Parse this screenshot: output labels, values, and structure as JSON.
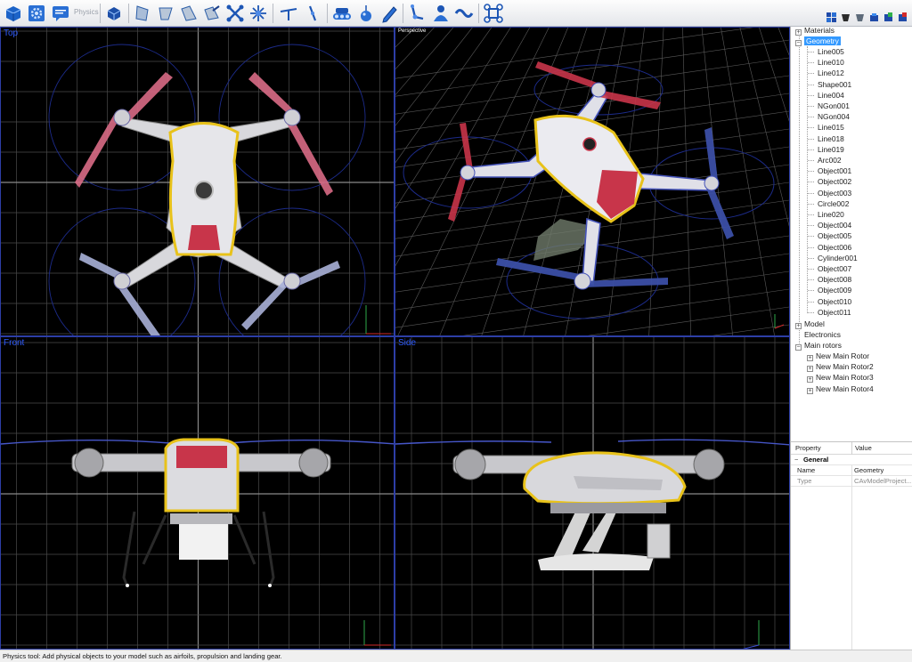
{
  "toolbar": {
    "physics_label": "Physics",
    "buttons": [
      {
        "name": "box-icon"
      },
      {
        "name": "gear-settings-icon"
      },
      {
        "name": "chat-icon"
      },
      {
        "name": "cube-physics-icon"
      },
      {
        "name": "wing-panel-icon"
      },
      {
        "name": "wing-taper-icon"
      },
      {
        "name": "wing-sweep-icon"
      },
      {
        "name": "wing-pen-icon"
      },
      {
        "name": "quadcopter-frame-icon"
      },
      {
        "name": "burst-icon"
      },
      {
        "name": "rotor-blade-icon"
      },
      {
        "name": "propeller-icon"
      },
      {
        "name": "tank-tracks-icon"
      },
      {
        "name": "drop-weight-icon"
      },
      {
        "name": "pencil-icon"
      },
      {
        "name": "joint-icon"
      },
      {
        "name": "person-icon"
      },
      {
        "name": "wave-icon"
      },
      {
        "name": "multirotor-icon"
      }
    ],
    "right_icons": [
      {
        "name": "tool-a-icon"
      },
      {
        "name": "tool-b-icon"
      },
      {
        "name": "tool-c-icon"
      },
      {
        "name": "tool-d-icon"
      },
      {
        "name": "tool-e-icon"
      },
      {
        "name": "tool-f-icon"
      }
    ]
  },
  "viewports": {
    "top": "Top",
    "perspective": "Perspective",
    "front": "Front",
    "side": "Side"
  },
  "tree": {
    "materials": "Materials",
    "geometry": "Geometry",
    "geometry_items": [
      "Line005",
      "Line010",
      "Line012",
      "Shape001",
      "Line004",
      "NGon001",
      "NGon004",
      "Line015",
      "Line018",
      "Line019",
      "Arc002",
      "Object001",
      "Object002",
      "Object003",
      "Circle002",
      "Line020",
      "Object004",
      "Object005",
      "Object006",
      "Cylinder001",
      "Object007",
      "Object008",
      "Object009",
      "Object010",
      "Object011"
    ],
    "model": "Model",
    "electronics": "Electronics",
    "main_rotors": "Main rotors",
    "rotor_items": [
      "New Main Rotor",
      "New Main Rotor2",
      "New Main Rotor3",
      "New Main Rotor4"
    ]
  },
  "props": {
    "col_property": "Property",
    "col_value": "Value",
    "section": "General",
    "rows": [
      {
        "name": "Name",
        "value": "Geometry"
      },
      {
        "name": "Type",
        "value": "CAvModelProject..."
      }
    ]
  },
  "status": "Physics tool: Add physical objects to your model such as airfoils, propulsion and landing gear.",
  "colors": {
    "accent": "#3399ff",
    "viewport_label": "#2f5cff",
    "outline": "#e8c21a",
    "rotor_red": "#c8354a",
    "rotor_blue": "#3b4fa6"
  }
}
